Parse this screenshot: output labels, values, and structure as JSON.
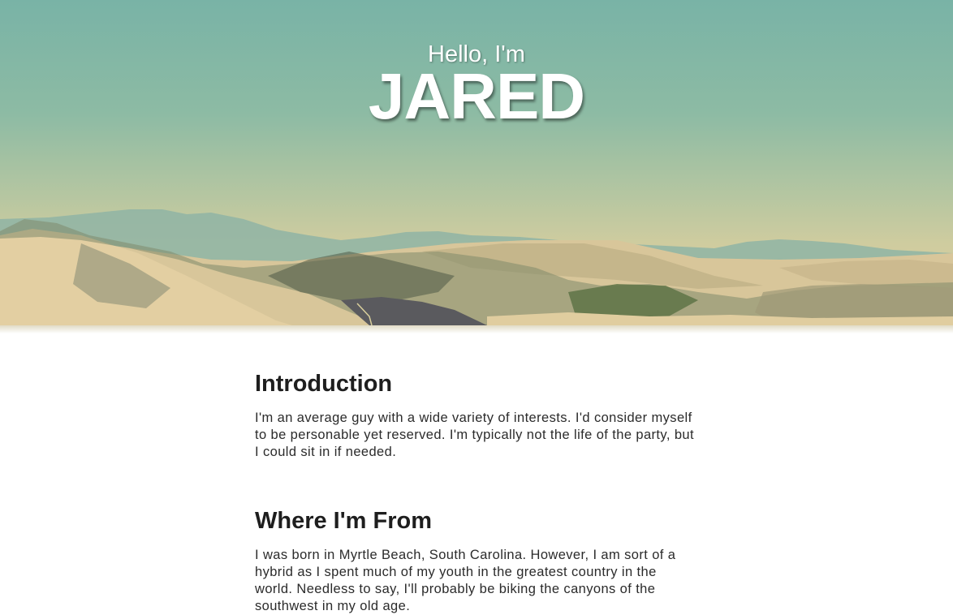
{
  "hero": {
    "greeting": "Hello, I'm",
    "name": "JARED"
  },
  "sections": [
    {
      "heading": "Introduction",
      "body": "I'm an average guy with a wide variety of interests. I'd consider myself to be personable yet reserved. I'm typically not the life of the party, but I could sit in if needed."
    },
    {
      "heading": "Where I'm From",
      "body": "I was born in Myrtle Beach, South Carolina. However, I am sort of a hybrid as I spent much of my youth in the greatest country in the world. Needless to say, I'll probably be biking the canyons of the southwest in my old age."
    }
  ]
}
